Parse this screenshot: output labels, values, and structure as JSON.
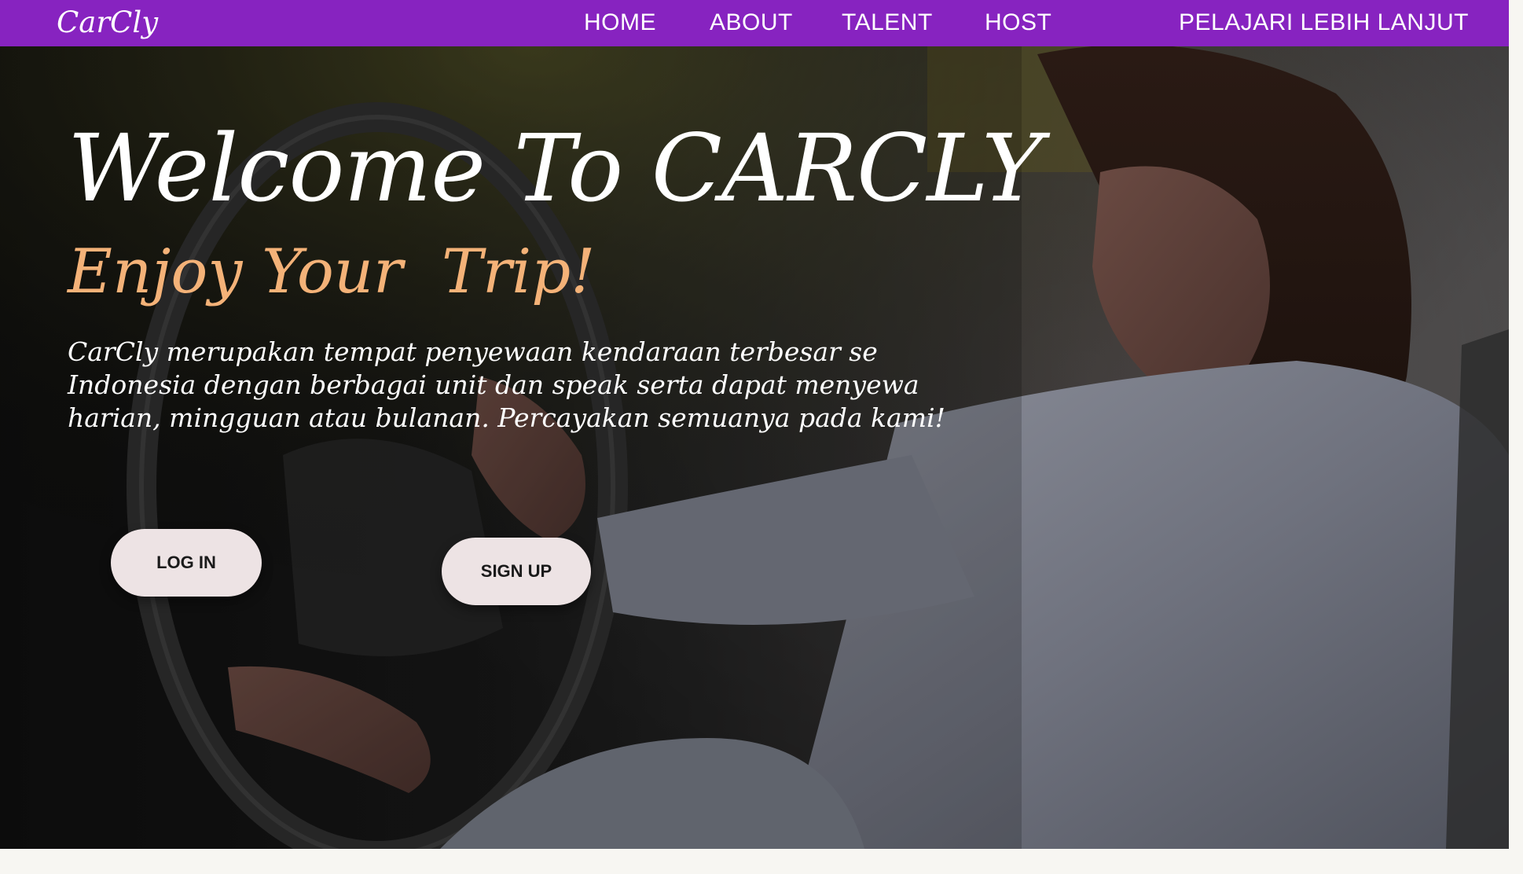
{
  "navbar": {
    "brand": "CarCly",
    "links": [
      "HOME",
      "ABOUT",
      "TALENT",
      "HOST"
    ],
    "cta": "PELAJARI LEBIH LANJUT",
    "color": "#8723c0"
  },
  "hero": {
    "title": "Welcome To CARCLY",
    "subtitle": "Enjoy Your  Trip!",
    "description": "CarCly merupakan tempat penyewaan kendaraan terbesar se Indonesia dengan berbagai unit dan speak serta dapat menyewa harian, mingguan atau bulanan. Percayakan semuanya pada kami!",
    "subtitle_color": "#f4b278",
    "background_image": "woman driving a car, smiling, holding steering wheel"
  },
  "buttons": {
    "login": "LOG IN",
    "signup": "SIGN UP",
    "color": "#ede3e4"
  }
}
